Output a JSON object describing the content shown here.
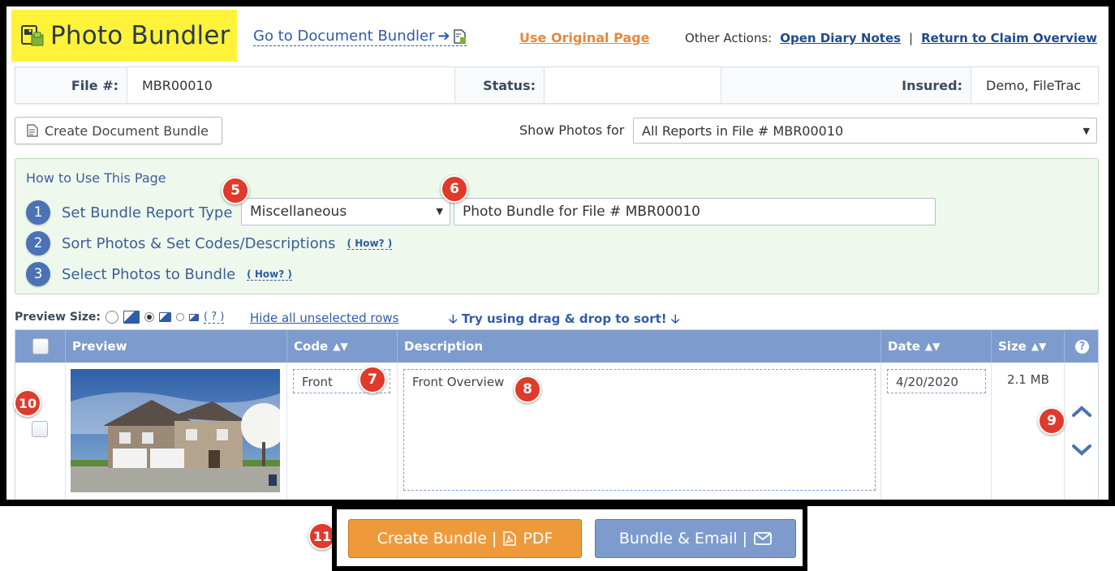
{
  "header": {
    "title": "Photo Bundler",
    "doc_bundler_link": "Go to Document Bundler",
    "use_original": "Use Original Page",
    "other_actions_label": "Other Actions:",
    "open_diary": "Open Diary Notes",
    "separator": "|",
    "return_claim": "Return to Claim Overview"
  },
  "info": {
    "file_label": "File #:",
    "file_value": "MBR00010",
    "status_label": "Status:",
    "status_value": "",
    "insured_label": "Insured:",
    "insured_value": "Demo, FileTrac"
  },
  "toolbar": {
    "create_doc_bundle": "Create Document Bundle",
    "show_photos_label": "Show Photos for",
    "show_photos_value": "All Reports in File # MBR00010"
  },
  "howto": {
    "title": "How to Use This Page",
    "steps": [
      {
        "num": "1",
        "label": "Set Bundle Report Type"
      },
      {
        "num": "2",
        "label": "Sort Photos & Set Codes/Descriptions",
        "link": "( How? )"
      },
      {
        "num": "3",
        "label": "Select Photos to Bundle",
        "link": "( How? )"
      }
    ],
    "report_type_value": "Miscellaneous",
    "bundle_title_value": "Photo Bundle for File # MBR00010"
  },
  "preview": {
    "label": "Preview Size:",
    "help": "( ? )",
    "hide_link": "Hide all unselected rows",
    "try_drag": "Try using drag & drop to sort!"
  },
  "table": {
    "headers": {
      "preview": "Preview",
      "code": "Code",
      "description": "Description",
      "date": "Date",
      "size": "Size"
    },
    "rows": [
      {
        "code": "Front",
        "description": "Front Overview",
        "date": "4/20/2020",
        "size": "2.1 MB"
      }
    ]
  },
  "badges": [
    "5",
    "6",
    "7",
    "8",
    "9",
    "10",
    "11"
  ],
  "actions": {
    "create_bundle": "Create Bundle |",
    "pdf": "PDF",
    "bundle_email": "Bundle & Email |"
  },
  "colors": {
    "brand_highlight": "#fff23a",
    "primary_blue": "#7d9ccd",
    "accent_orange": "#ef9a3a",
    "badge_red": "#e03a2b",
    "howto_green": "#eef8ec"
  }
}
